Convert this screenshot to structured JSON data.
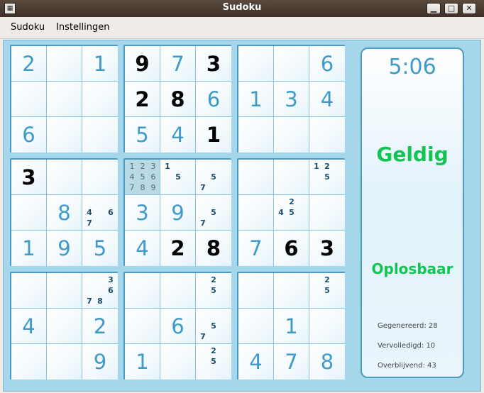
{
  "window": {
    "title": "Sudoku",
    "icon": "sudoku-app-icon",
    "buttons": [
      "minimize",
      "maximize",
      "close"
    ]
  },
  "menu": [
    "Sudoku",
    "Instellingen"
  ],
  "board": {
    "cells": [
      [
        "2",
        "",
        "1",
        "9",
        "7",
        "3",
        "",
        "",
        "6"
      ],
      [
        "",
        "",
        "",
        "2",
        "8",
        "6",
        "1",
        "3",
        "4"
      ],
      [
        "6",
        "",
        "",
        "5",
        "4",
        "1",
        "",
        "",
        ""
      ],
      [
        "3",
        "",
        "",
        "",
        "",
        "",
        "",
        "",
        ""
      ],
      [
        "",
        "8",
        "",
        "3",
        "9",
        "",
        "",
        "",
        ""
      ],
      [
        "1",
        "9",
        "5",
        "4",
        "2",
        "8",
        "7",
        "6",
        "3"
      ],
      [
        "",
        "",
        "",
        "",
        "",
        "",
        "",
        "",
        ""
      ],
      [
        "4",
        "",
        "2",
        "",
        "6",
        "",
        "",
        "1",
        ""
      ],
      [
        "",
        "",
        "9",
        "1",
        "",
        "",
        "4",
        "7",
        "8"
      ]
    ],
    "given": [
      [
        0,
        3
      ],
      [
        0,
        5
      ],
      [
        1,
        3
      ],
      [
        1,
        4
      ],
      [
        2,
        5
      ],
      [
        3,
        0
      ],
      [
        5,
        4
      ],
      [
        5,
        5
      ],
      [
        5,
        7
      ],
      [
        5,
        8
      ]
    ],
    "highlight": [
      3,
      3
    ],
    "notes": [
      {
        "r": 3,
        "c": 3,
        "n": [
          "1",
          "2",
          "3",
          "4",
          "5",
          "6",
          "7",
          "8",
          "9"
        ]
      },
      {
        "r": 3,
        "c": 4,
        "n": [
          "1",
          "",
          "",
          "",
          "5",
          "",
          "",
          "",
          ""
        ]
      },
      {
        "r": 3,
        "c": 5,
        "n": [
          "",
          "",
          "",
          "",
          "5",
          "",
          "7",
          "",
          ""
        ]
      },
      {
        "r": 3,
        "c": 8,
        "n": [
          "1",
          "2",
          "",
          "",
          "5",
          "",
          "",
          "",
          ""
        ]
      },
      {
        "r": 4,
        "c": 2,
        "n": [
          "",
          "",
          "",
          "4",
          "",
          "6",
          "7",
          "",
          ""
        ]
      },
      {
        "r": 4,
        "c": 5,
        "n": [
          "",
          "",
          "",
          "",
          "5",
          "",
          "7",
          "",
          ""
        ]
      },
      {
        "r": 4,
        "c": 7,
        "n": [
          "",
          "2",
          "",
          "4",
          "5",
          "",
          "",
          "",
          ""
        ]
      },
      {
        "r": 6,
        "c": 2,
        "n": [
          "",
          "",
          "3",
          "",
          "",
          "6",
          "7",
          "8",
          ""
        ]
      },
      {
        "r": 6,
        "c": 5,
        "n": [
          "",
          "2",
          "",
          "",
          "5",
          "",
          "",
          "",
          ""
        ]
      },
      {
        "r": 6,
        "c": 8,
        "n": [
          "",
          "2",
          "",
          "",
          "5",
          "",
          "",
          "",
          ""
        ]
      },
      {
        "r": 7,
        "c": 5,
        "n": [
          "",
          "",
          "",
          "",
          "5",
          "",
          "7",
          "",
          ""
        ]
      },
      {
        "r": 8,
        "c": 5,
        "n": [
          "",
          "2",
          "",
          "",
          "5",
          "",
          "",
          "",
          ""
        ]
      }
    ]
  },
  "panel": {
    "timer": "5:06",
    "status_valid": "Geldig",
    "status_solvable": "Oplosbaar",
    "stats": {
      "generated": "Gegenereerd: 28",
      "completed": "Vervolledigd: 10",
      "remaining": "Overblijvend: 43"
    }
  },
  "colors": {
    "given": "#000000",
    "entered": "#3e9ac8",
    "status": "#13c454",
    "board_bg": "#a6d6ea"
  }
}
